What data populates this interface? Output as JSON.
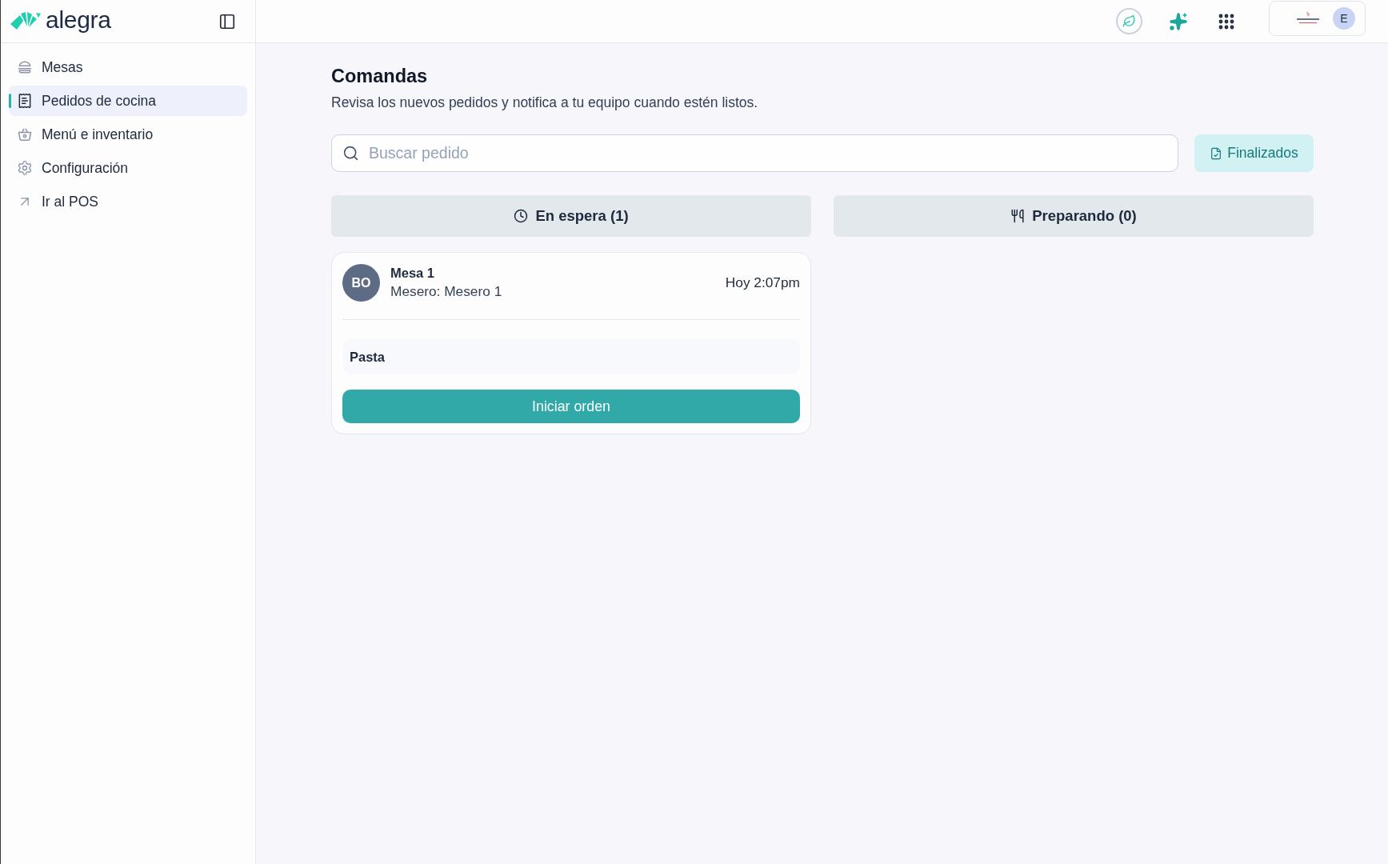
{
  "sidebar": {
    "logo": "alegra",
    "items": [
      {
        "label": "Mesas",
        "selected": false
      },
      {
        "label": "Pedidos de cocina",
        "selected": true
      },
      {
        "label": "Menú e inventario",
        "selected": false
      },
      {
        "label": "Configuración",
        "selected": false
      },
      {
        "label": "Ir al POS",
        "selected": false
      }
    ]
  },
  "header": {
    "account_avatar": "E"
  },
  "page": {
    "title": "Comandas",
    "subtitle": "Revisa los nuevos pedidos y notifica a tu equipo cuando estén listos."
  },
  "search": {
    "placeholder": "Buscar pedido"
  },
  "finished_button": "Finalizados",
  "columns": [
    {
      "tab": "En espera (1)",
      "orders": [
        {
          "initials": "BO",
          "table": "Mesa 1",
          "waiter": "Mesero: Mesero 1",
          "time": "Hoy 2:07pm",
          "items": [
            "Pasta"
          ],
          "action": "Iniciar orden"
        }
      ]
    },
    {
      "tab": "Preparando (0)"
    }
  ]
}
